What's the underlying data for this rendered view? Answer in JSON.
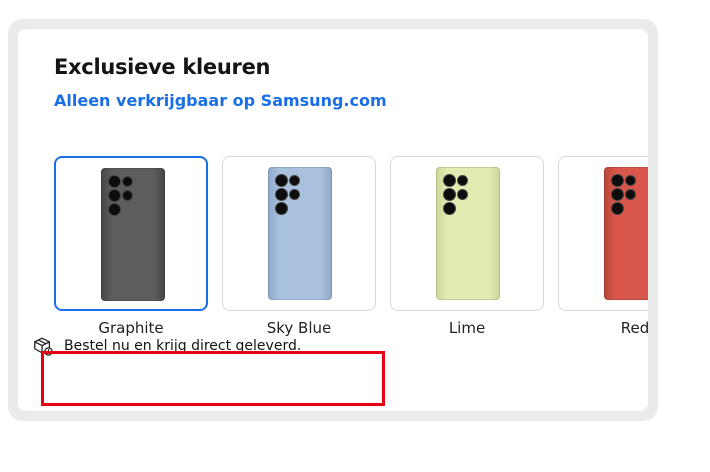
{
  "section": {
    "title": "Exclusieve kleuren",
    "subtitle_link": "Alleen verkrijgbaar op Samsung.com"
  },
  "colors": [
    {
      "label": "Graphite",
      "selected": true,
      "phone_color": "#5b5d5f",
      "phone_color_dark": "#444648"
    },
    {
      "label": "Sky Blue",
      "selected": false,
      "phone_color": "#a9c1df",
      "phone_color_dark": "#8fa9c9"
    },
    {
      "label": "Lime",
      "selected": false,
      "phone_color": "#e2ebb2",
      "phone_color_dark": "#ccd79a"
    },
    {
      "label": "Red",
      "selected": false,
      "phone_color": "#d9574a",
      "phone_color_dark": "#b8463b"
    }
  ],
  "delivery": {
    "icon": "package-delivery-icon",
    "text": "Bestel nu en krijg direct geleverd."
  },
  "theme": {
    "accent": "#1a6ee6",
    "highlight_border": "#e60012",
    "frame_bg": "#ebebeb"
  }
}
